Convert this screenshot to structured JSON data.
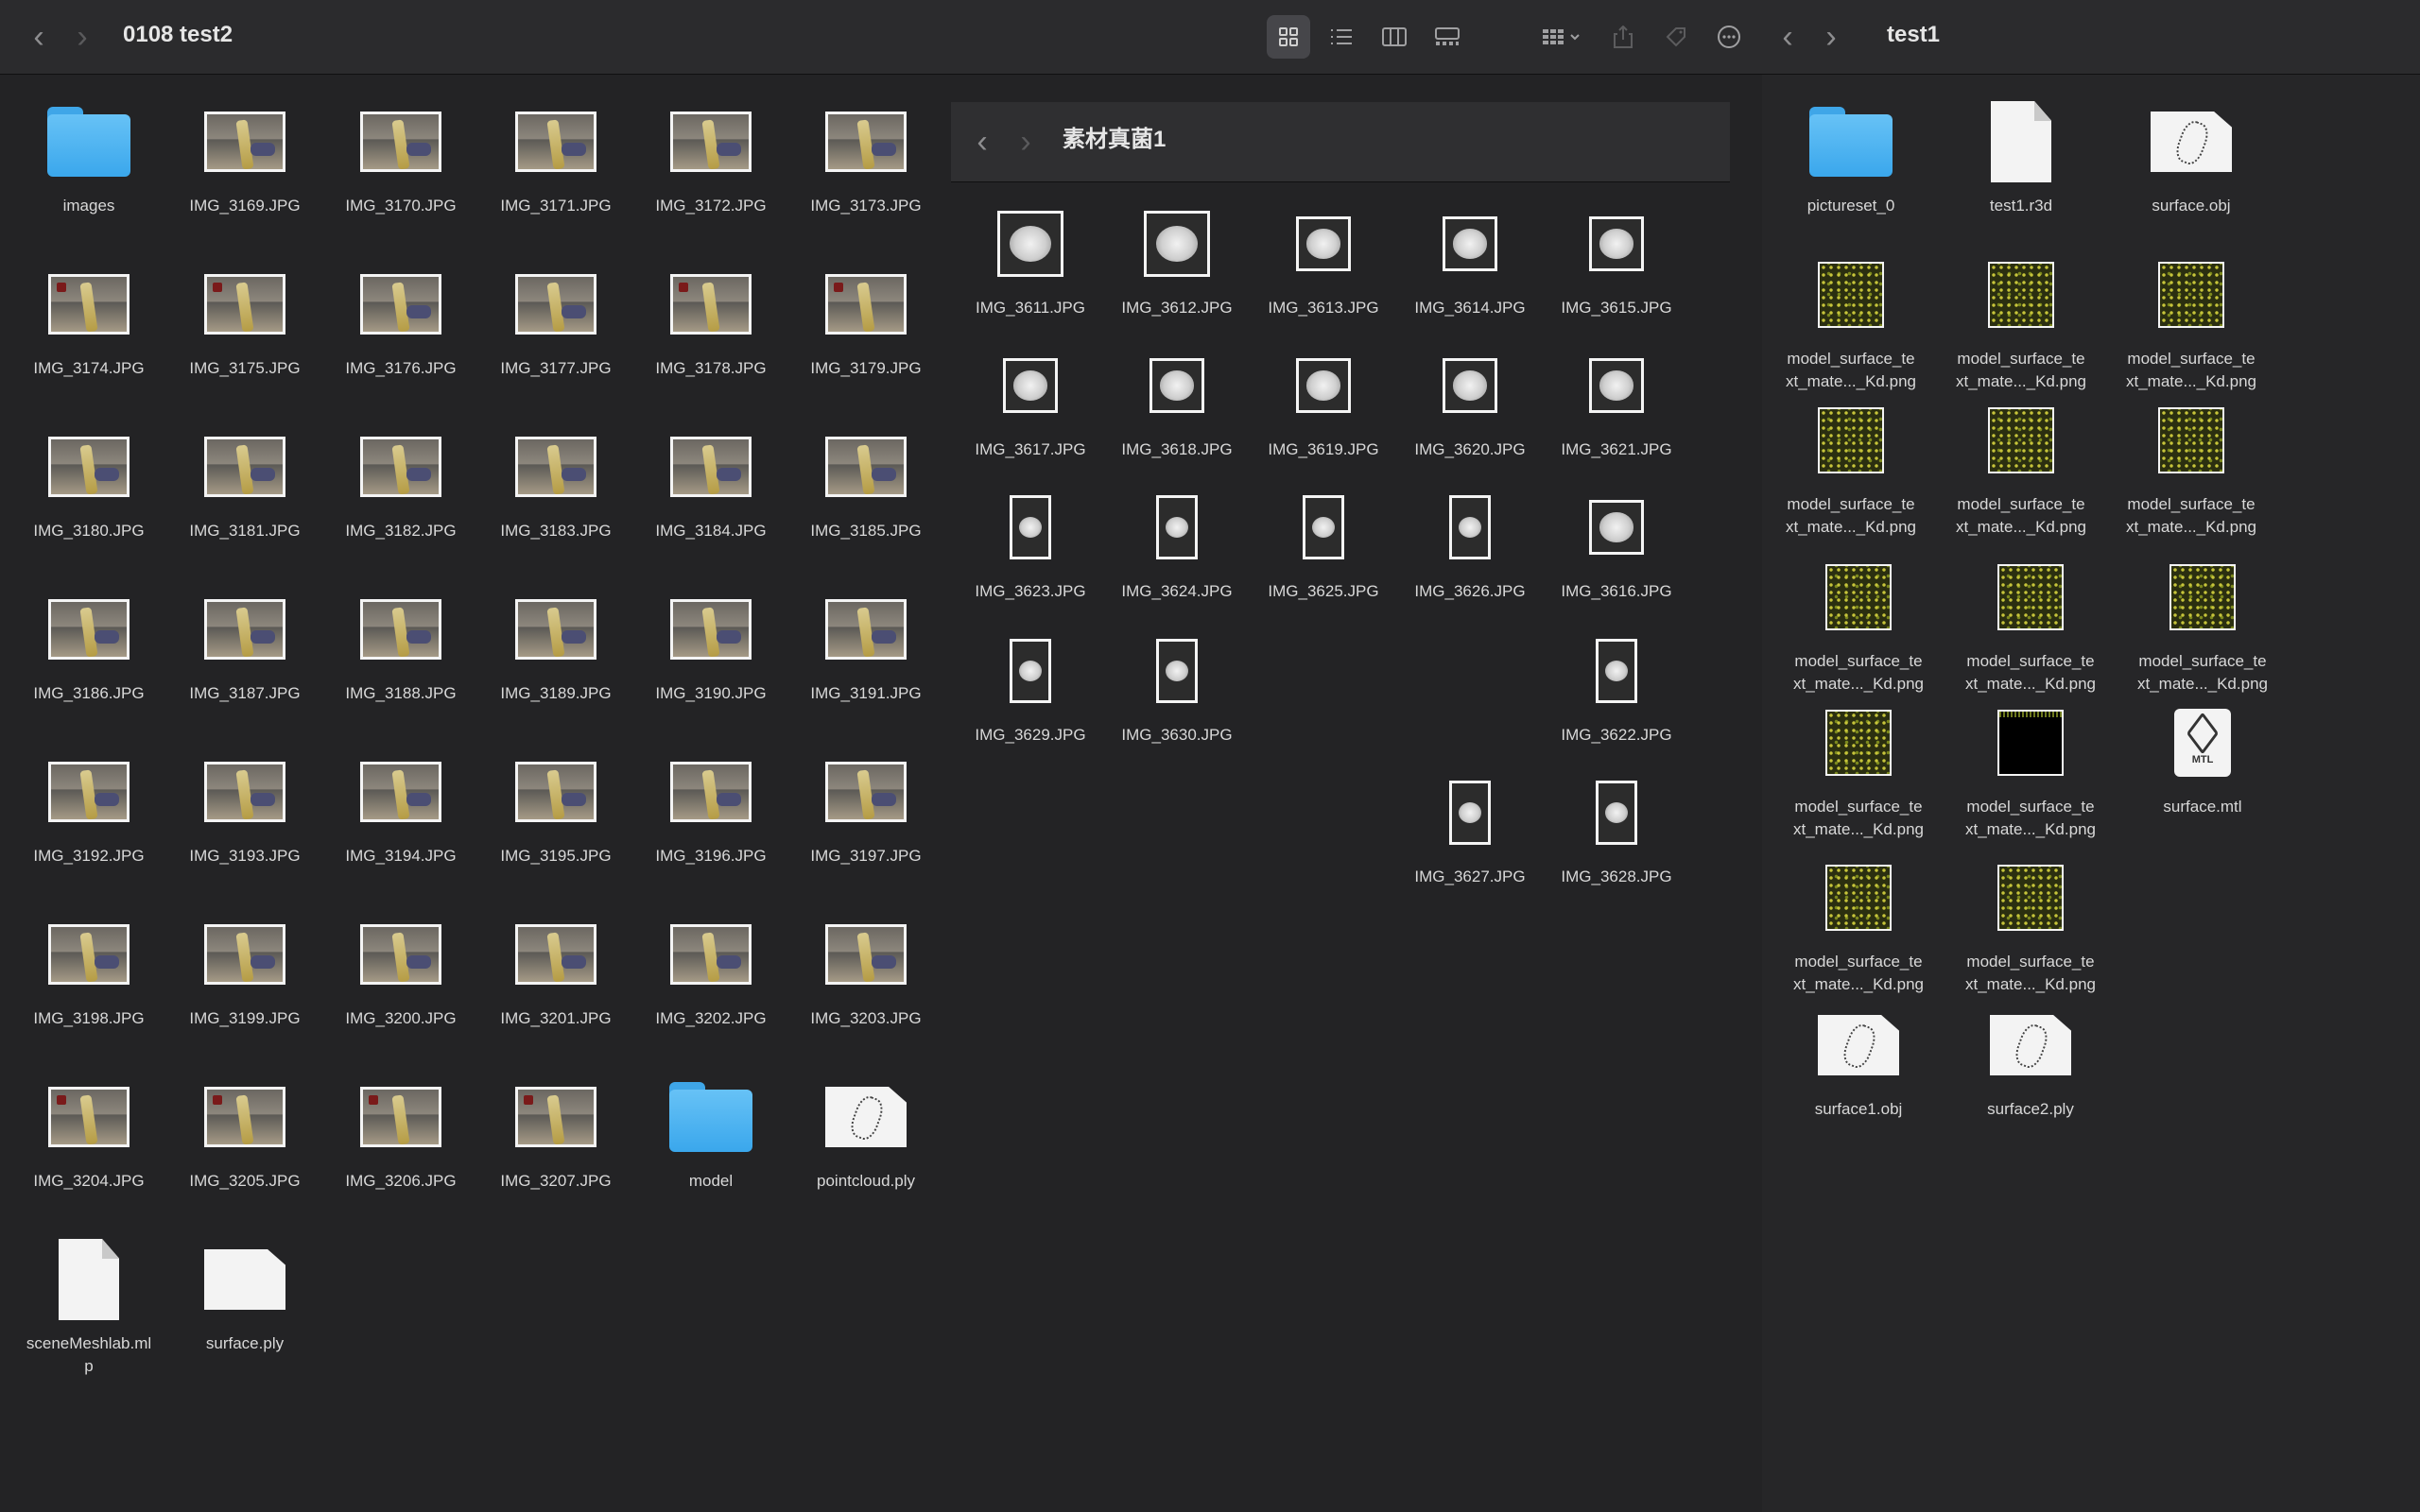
{
  "left_window": {
    "title": "0108 test2",
    "items": [
      {
        "label": "images",
        "type": "folder"
      },
      {
        "label": "IMG_3169.JPG",
        "type": "photo"
      },
      {
        "label": "IMG_3170.JPG",
        "type": "photo"
      },
      {
        "label": "IMG_3171.JPG",
        "type": "photo"
      },
      {
        "label": "IMG_3172.JPG",
        "type": "photo"
      },
      {
        "label": "IMG_3173.JPG",
        "type": "photo"
      },
      {
        "label": "IMG_3174.JPG",
        "type": "photo-red"
      },
      {
        "label": "IMG_3175.JPG",
        "type": "photo-red"
      },
      {
        "label": "IMG_3176.JPG",
        "type": "photo"
      },
      {
        "label": "IMG_3177.JPG",
        "type": "photo"
      },
      {
        "label": "IMG_3178.JPG",
        "type": "photo-red"
      },
      {
        "label": "IMG_3179.JPG",
        "type": "photo-red"
      },
      {
        "label": "IMG_3180.JPG",
        "type": "photo"
      },
      {
        "label": "IMG_3181.JPG",
        "type": "photo"
      },
      {
        "label": "IMG_3182.JPG",
        "type": "photo"
      },
      {
        "label": "IMG_3183.JPG",
        "type": "photo"
      },
      {
        "label": "IMG_3184.JPG",
        "type": "photo"
      },
      {
        "label": "IMG_3185.JPG",
        "type": "photo"
      },
      {
        "label": "IMG_3186.JPG",
        "type": "photo"
      },
      {
        "label": "IMG_3187.JPG",
        "type": "photo"
      },
      {
        "label": "IMG_3188.JPG",
        "type": "photo"
      },
      {
        "label": "IMG_3189.JPG",
        "type": "photo"
      },
      {
        "label": "IMG_3190.JPG",
        "type": "photo"
      },
      {
        "label": "IMG_3191.JPG",
        "type": "photo"
      },
      {
        "label": "IMG_3192.JPG",
        "type": "photo"
      },
      {
        "label": "IMG_3193.JPG",
        "type": "photo"
      },
      {
        "label": "IMG_3194.JPG",
        "type": "photo"
      },
      {
        "label": "IMG_3195.JPG",
        "type": "photo"
      },
      {
        "label": "IMG_3196.JPG",
        "type": "photo"
      },
      {
        "label": "IMG_3197.JPG",
        "type": "photo"
      },
      {
        "label": "IMG_3198.JPG",
        "type": "photo"
      },
      {
        "label": "IMG_3199.JPG",
        "type": "photo"
      },
      {
        "label": "IMG_3200.JPG",
        "type": "photo"
      },
      {
        "label": "IMG_3201.JPG",
        "type": "photo"
      },
      {
        "label": "IMG_3202.JPG",
        "type": "photo"
      },
      {
        "label": "IMG_3203.JPG",
        "type": "photo"
      },
      {
        "label": "IMG_3204.JPG",
        "type": "photo-red"
      },
      {
        "label": "IMG_3205.JPG",
        "type": "photo-red"
      },
      {
        "label": "IMG_3206.JPG",
        "type": "photo-red"
      },
      {
        "label": "IMG_3207.JPG",
        "type": "photo-red"
      },
      {
        "label": "model",
        "type": "folder"
      },
      {
        "label": "pointcloud.ply",
        "type": "model-doc"
      },
      {
        "label": "sceneMeshlab.ml\np",
        "type": "doc"
      },
      {
        "label": "surface.ply",
        "type": "doc-wide"
      }
    ]
  },
  "middle_window": {
    "title": "素材真菌1",
    "items": [
      {
        "label": "IMG_3611.JPG",
        "type": "mush-big"
      },
      {
        "label": "IMG_3612.JPG",
        "type": "mush-big"
      },
      {
        "label": "IMG_3613.JPG",
        "type": "mush"
      },
      {
        "label": "IMG_3614.JPG",
        "type": "mush"
      },
      {
        "label": "IMG_3615.JPG",
        "type": "mush"
      },
      {
        "label": "IMG_3617.JPG",
        "type": "mush"
      },
      {
        "label": "IMG_3618.JPG",
        "type": "mush"
      },
      {
        "label": "IMG_3619.JPG",
        "type": "mush"
      },
      {
        "label": "IMG_3620.JPG",
        "type": "mush"
      },
      {
        "label": "IMG_3621.JPG",
        "type": "mush"
      },
      {
        "label": "IMG_3623.JPG",
        "type": "mush-tall"
      },
      {
        "label": "IMG_3624.JPG",
        "type": "mush-tall"
      },
      {
        "label": "IMG_3625.JPG",
        "type": "mush-tall"
      },
      {
        "label": "IMG_3626.JPG",
        "type": "mush-tall"
      },
      {
        "label": "IMG_3616.JPG",
        "type": "mush"
      },
      {
        "label": "IMG_3629.JPG",
        "type": "mush-tall"
      },
      {
        "label": "IMG_3630.JPG",
        "type": "mush-tall"
      },
      {
        "label": "IMG_3622.JPG",
        "type": "mush-tall"
      },
      {
        "label": "IMG_3627.JPG",
        "type": "mush-tall"
      },
      {
        "label": "IMG_3628.JPG",
        "type": "mush-tall"
      }
    ]
  },
  "right_window": {
    "title": "test1",
    "items": [
      {
        "label": "pictureset_0",
        "type": "folder"
      },
      {
        "label": "test1.r3d",
        "type": "doc"
      },
      {
        "label": "surface.obj",
        "type": "model-doc"
      },
      {
        "label": "model_surface_te\nxt_mate..._Kd.png",
        "type": "tex"
      },
      {
        "label": "model_surface_te\nxt_mate..._Kd.png",
        "type": "tex"
      },
      {
        "label": "model_surface_te\nxt_mate..._Kd.png",
        "type": "tex"
      },
      {
        "label": "model_surface_te\nxt_mate..._Kd.png",
        "type": "tex"
      },
      {
        "label": "model_surface_te\nxt_mate..._Kd.png",
        "type": "tex"
      },
      {
        "label": "model_surface_te\nxt_mate..._Kd.png",
        "type": "tex"
      },
      {
        "label": "model_surface_te\nxt_mate..._Kd.png",
        "type": "tex"
      },
      {
        "label": "model_surface_te\nxt_mate..._Kd.png",
        "type": "tex"
      },
      {
        "label": "model_surface_te\nxt_mate..._Kd.png",
        "type": "tex"
      },
      {
        "label": "model_surface_te\nxt_mate..._Kd.png",
        "type": "tex"
      },
      {
        "label": "model_surface_te\nxt_mate..._Kd.png",
        "type": "tex-black"
      },
      {
        "label": "surface.mtl",
        "type": "mtl"
      },
      {
        "label": "model_surface_te\nxt_mate..._Kd.png",
        "type": "tex"
      },
      {
        "label": "model_surface_te\nxt_mate..._Kd.png",
        "type": "tex"
      },
      {
        "label": "surface1.obj",
        "type": "model-doc"
      },
      {
        "label": "surface2.ply",
        "type": "model-doc"
      }
    ],
    "mtl_text": "MTL"
  },
  "toolbar_icons": [
    "icon-view-icon",
    "list-view-icon",
    "column-view-icon",
    "gallery-view-icon",
    "group-icon",
    "share-icon",
    "tag-icon",
    "more-icon"
  ],
  "colors": {
    "folder": "#3fa6e8",
    "window_bg": "#232325",
    "toolbar_bg": "#2b2b2d"
  }
}
